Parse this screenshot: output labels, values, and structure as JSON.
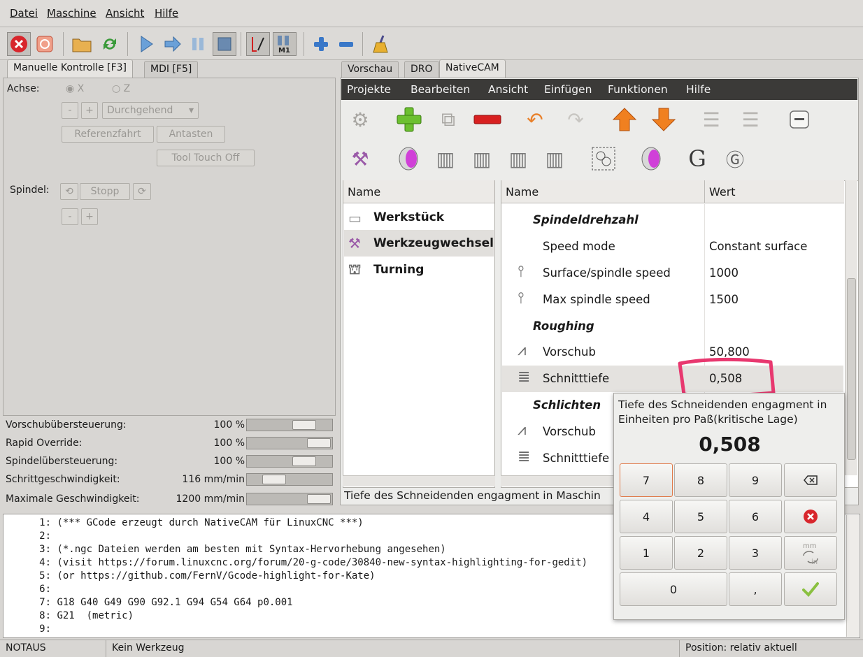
{
  "menubar": [
    "Datei",
    "Maschine",
    "Ansicht",
    "Hilfe"
  ],
  "left_tabs": [
    "Manuelle Kontrolle [F3]",
    "MDI [F5]"
  ],
  "manual": {
    "axis_label": "Achse:",
    "axis_x": "X",
    "axis_z": "Z",
    "minus": "-",
    "plus": "+",
    "jog_mode": "Durchgehend",
    "home_button": "Referenzfahrt",
    "touch_button": "Antasten",
    "tool_touch_off": "Tool Touch Off",
    "spindle_label": "Spindel:",
    "spindle_stop": "Stopp"
  },
  "overrides": [
    {
      "label": "Vorschubübersteuerung:",
      "value": "100 %",
      "level": 0.75
    },
    {
      "label": "Rapid Override:",
      "value": "100 %",
      "level": 1.0
    },
    {
      "label": "Spindelübersteuerung:",
      "value": "100 %",
      "level": 0.75
    },
    {
      "label": "Schrittgeschwindigkeit:",
      "value": "116 mm/min",
      "level": 0.25
    },
    {
      "label": "Maximale Geschwindigkeit:",
      "value": "1200 mm/min",
      "level": 1.0
    }
  ],
  "right_tabs": [
    "Vorschau",
    "DRO",
    "NativeCAM"
  ],
  "nativecam_menu": [
    "Projekte",
    "Bearbeiten",
    "Ansicht",
    "Einfügen",
    "Funktionen",
    "Hilfe"
  ],
  "tree": {
    "header": "Name",
    "items": [
      "Werkstück",
      "Werkzeugwechsel",
      "Turning"
    ]
  },
  "params": {
    "col_name": "Name",
    "col_value": "Wert",
    "rows": [
      {
        "name": "Spindeldrehzahl",
        "value": "",
        "header": true
      },
      {
        "name": "Speed mode",
        "value": "Constant surface"
      },
      {
        "name": "Surface/spindle speed",
        "value": "1000"
      },
      {
        "name": "Max spindle speed",
        "value": "1500"
      },
      {
        "name": "Roughing",
        "value": "",
        "header": true
      },
      {
        "name": "Vorschub",
        "value": "50,800"
      },
      {
        "name": "Schnitttiefe",
        "value": "0,508"
      },
      {
        "name": "Schlichten",
        "value": "",
        "header": true
      },
      {
        "name": "Vorschub",
        "value": ""
      },
      {
        "name": "Schnitttiefe",
        "value": ""
      }
    ]
  },
  "hint_text": "Tiefe des Schneidenden engagment in Maschin",
  "popup": {
    "description": "Tiefe des Schneidenden engagment in Einheiten pro Paß(kritische Lage)",
    "value": "0,508",
    "keys": [
      "7",
      "8",
      "9",
      "4",
      "5",
      "6",
      "1",
      "2",
      "3",
      "0",
      ","
    ]
  },
  "gcode": [
    {
      "n": "1:",
      "t": "(*** GCode erzeugt durch NativeCAM für LinuxCNC ***)"
    },
    {
      "n": "2:",
      "t": ""
    },
    {
      "n": "3:",
      "t": "(*.ngc Dateien werden am besten mit Syntax-Hervorhebung angesehen)"
    },
    {
      "n": "4:",
      "t": "(visit https://forum.linuxcnc.org/forum/20-g-code/30840-new-syntax-highlighting-for-gedit)"
    },
    {
      "n": "5:",
      "t": "(or https://github.com/FernV/Gcode-highlight-for-Kate)"
    },
    {
      "n": "6:",
      "t": ""
    },
    {
      "n": "7:",
      "t": "G18 G40 G49 G90 G92.1 G94 G54 G64 p0.001"
    },
    {
      "n": "8:",
      "t": "G21  (metric)"
    },
    {
      "n": "9:",
      "t": ""
    }
  ],
  "statusbar": {
    "estop": "NOTAUS",
    "tool": "Kein Werkzeug",
    "position": "Position: relativ aktuell"
  },
  "colors": {
    "accent_highlight": "#e8386f",
    "menu_dark": "#3b3a38"
  }
}
